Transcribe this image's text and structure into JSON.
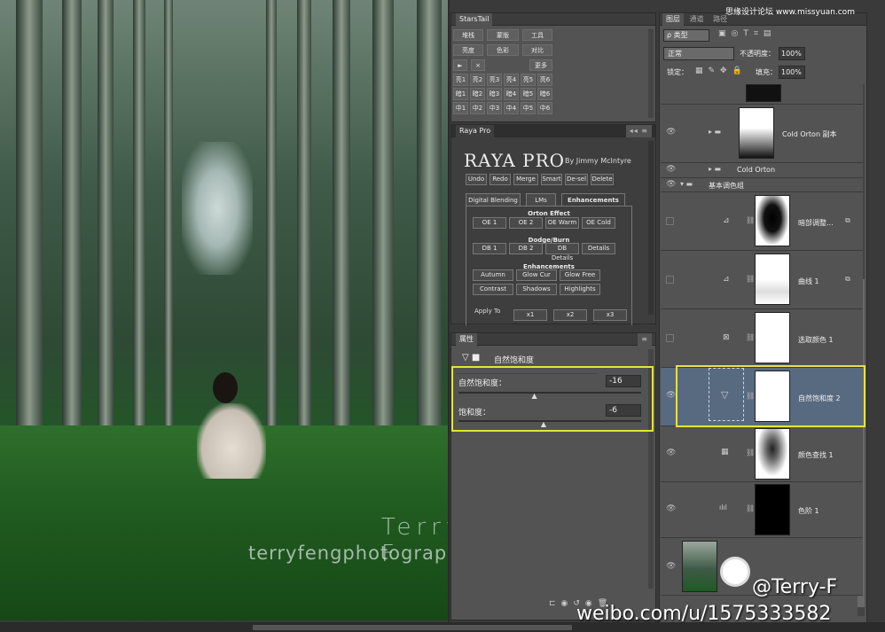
{
  "photo": {
    "watermark_name": "Terry F",
    "watermark_site": "terryfengphotography.lofter.com"
  },
  "overlay": {
    "site_logo": "思缘设计论坛 www.missyuan.com",
    "weibo_handle": "@Terry-F",
    "weibo_url": "weibo.com/u/1575333582"
  },
  "starstail": {
    "title": "StarsTail",
    "row1": [
      "堆栈",
      "蒙版",
      "工具"
    ],
    "row2": [
      "亮度",
      "色彩",
      "对比"
    ],
    "row3": [
      "►",
      "×",
      "更多"
    ],
    "grid": [
      [
        "亮1",
        "亮2",
        "亮3",
        "亮4",
        "亮5",
        "亮6"
      ],
      [
        "暗1",
        "暗2",
        "暗3",
        "暗4",
        "暗5",
        "暗6"
      ],
      [
        "中1",
        "中2",
        "中3",
        "中4",
        "中5",
        "中6"
      ]
    ]
  },
  "raya": {
    "title": "Raya Pro",
    "logo": "RAYA PRO",
    "byline": "By Jimmy McIntyre",
    "toolbar": [
      "Undo",
      "Redo",
      "Merge",
      "Smart",
      "De-sel",
      "Delete"
    ],
    "tabs": [
      "Digital Blending",
      "LMs",
      "Enhancements"
    ],
    "orton_label": "Orton Effect",
    "orton": [
      "OE 1",
      "OE 2",
      "OE Warm",
      "OE Cold"
    ],
    "db_label": "Dodge/Burn",
    "db": [
      "DB 1",
      "DB 2",
      "DB Details",
      "Details"
    ],
    "enh_label": "Enhancements",
    "enh1": [
      "Autumn",
      "Glow Cur",
      "Glow Free"
    ],
    "enh2": [
      "Contrast",
      "Shadows",
      "Highlights"
    ],
    "apply_to": "Apply To",
    "apply": [
      "x1",
      "x2",
      "x3"
    ]
  },
  "properties": {
    "title": "属性",
    "adjustment": "自然饱和度",
    "vibrance_label": "自然饱和度：",
    "vibrance_value": "-16",
    "vibrance_level": 0.42,
    "saturation_label": "饱和度：",
    "saturation_value": "-6",
    "saturation_level": 0.47
  },
  "layers": {
    "tabs": [
      "图层",
      "通道",
      "路径"
    ],
    "filter_kind": "ρ 类型",
    "blend_mode": "正常",
    "opacity_label": "不透明度：",
    "opacity": "100%",
    "lock_label": "锁定：",
    "fill_label": "填充：",
    "fill": "100%",
    "rows": [
      {
        "name": "Cold Orton 副本"
      },
      {
        "name": "Cold Orton"
      },
      {
        "name": "基本调色组"
      },
      {
        "name": "暗部调整..."
      },
      {
        "name": "曲线 1"
      },
      {
        "name": "选取颜色 1"
      },
      {
        "name": "自然饱和度 2"
      },
      {
        "name": "颜色查找 1"
      },
      {
        "name": "色阶 1"
      }
    ]
  }
}
